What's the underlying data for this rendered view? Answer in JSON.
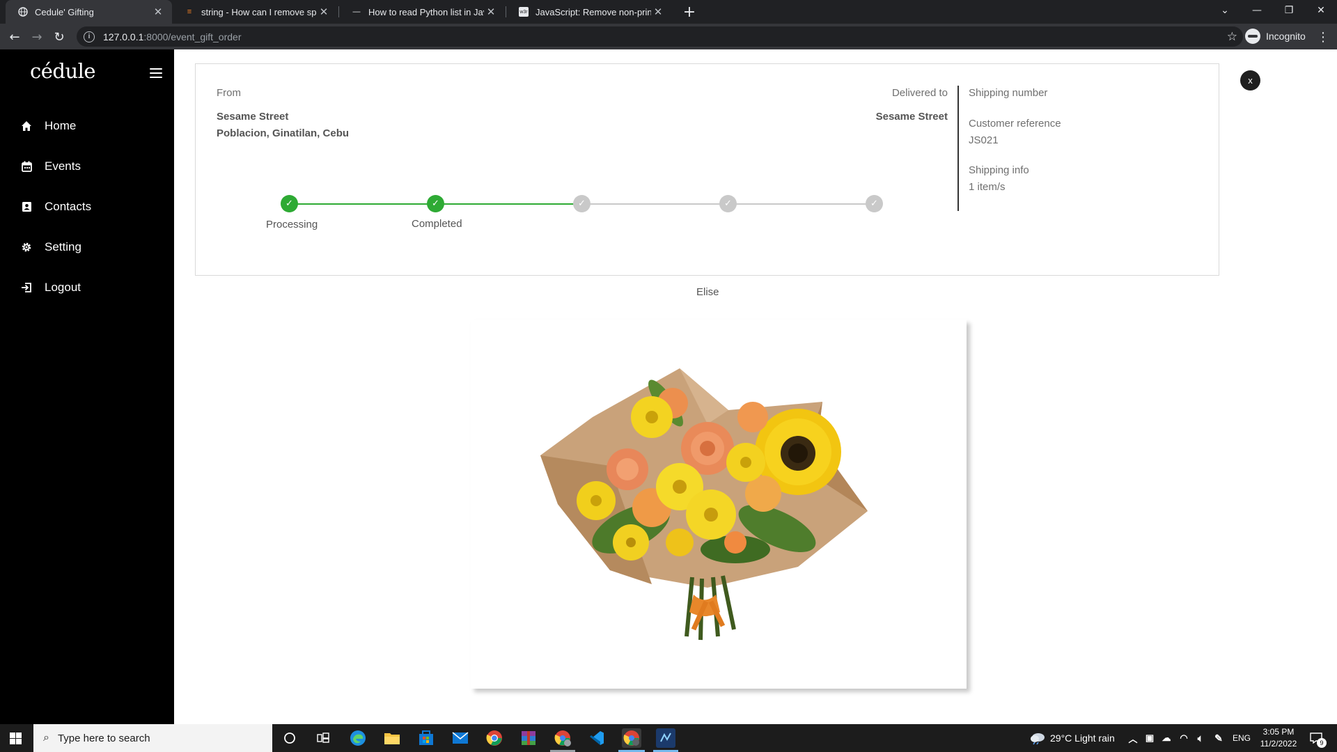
{
  "browser": {
    "tabs": [
      {
        "title": "Cedule' Gifting",
        "icon": "globe-icon"
      },
      {
        "title": "string - How can I remove specia",
        "icon": "stackoverflow-icon"
      },
      {
        "title": "How to read Python list in Javasc",
        "icon": "devto-icon"
      },
      {
        "title": "JavaScript: Remove non-printable",
        "icon": "w3r-icon"
      }
    ],
    "url_host": "127.0.0.1",
    "url_path": ":8000/event_gift_order",
    "incognito_label": "Incognito"
  },
  "sidebar": {
    "logo": "cédule",
    "items": [
      {
        "label": "Home",
        "icon": "home-icon"
      },
      {
        "label": "Events",
        "icon": "calendar-icon"
      },
      {
        "label": "Contacts",
        "icon": "contact-card-icon"
      },
      {
        "label": "Setting",
        "icon": "gear-icon"
      },
      {
        "label": "Logout",
        "icon": "logout-icon"
      }
    ]
  },
  "order": {
    "from_label": "From",
    "from_line1": "Sesame Street",
    "from_line2": "Poblacion, Ginatilan, Cebu",
    "delivered_label": "Delivered to",
    "delivered_value": "Sesame Street",
    "shipping_number_label": "Shipping number",
    "customer_ref_label": "Customer reference",
    "customer_ref_value": "JS021",
    "shipping_info_label": "Shipping info",
    "shipping_info_value": "1 item/s",
    "steps": [
      {
        "label": "Processing",
        "done": true
      },
      {
        "label": "Completed",
        "done": true
      },
      {
        "label": "",
        "done": false
      },
      {
        "label": "",
        "done": false
      },
      {
        "label": "",
        "done": false
      }
    ],
    "close_label": "x",
    "recipient": "Elise",
    "gift_image": "flower-bouquet"
  },
  "taskbar": {
    "search_placeholder": "Type here to search",
    "weather": "29°C  Light rain",
    "language": "ENG",
    "time": "3:05 PM",
    "date": "11/2/2022",
    "notification_count": "9"
  },
  "colors": {
    "accent_done": "#2eaa34",
    "step_todo": "#c9c9c9",
    "sidebar_bg": "#000000"
  }
}
